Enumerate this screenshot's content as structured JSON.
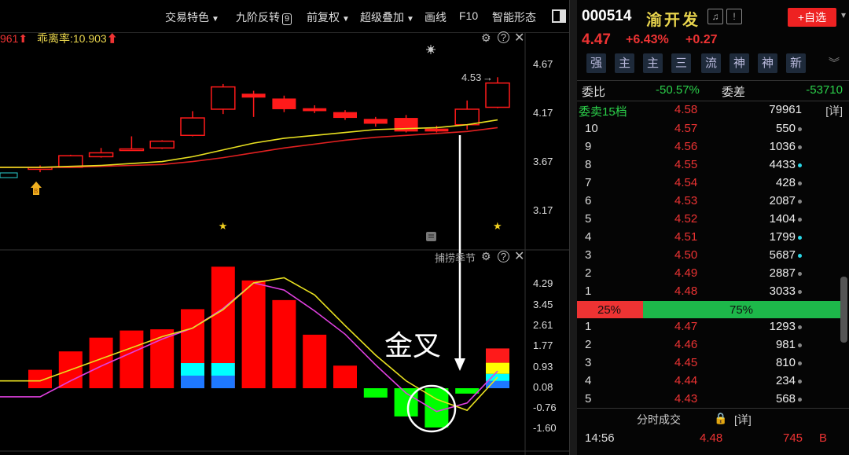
{
  "toolbar": {
    "items": [
      "交易特色",
      "九阶反转",
      "前复权",
      "超级叠加",
      "画线",
      "F10",
      "智能形态"
    ],
    "badge": "9"
  },
  "main_legend": {
    "prev_value": "961",
    "label": "乖离率:10.903"
  },
  "main_axis": [
    "4.67",
    "4.17",
    "3.67",
    "3.17"
  ],
  "price_label": "4.53",
  "sub_legend": "捕捞季节",
  "sub_axis": [
    "4.29",
    "3.45",
    "2.61",
    "1.77",
    "0.93",
    "0.08",
    "-0.76",
    "-1.60"
  ],
  "annotation": "金叉",
  "stock": {
    "code": "000514",
    "name": "渝开发",
    "price": "4.47",
    "pct": "+6.43%",
    "chg": "+0.27",
    "add_label": "+自选",
    "tags": [
      "强",
      "主",
      "主",
      "三",
      "流",
      "神",
      "神",
      "新"
    ]
  },
  "ratio": {
    "webi_label": "委比",
    "webi_value": "-50.57%",
    "wecha_label": "委差",
    "wecha_value": "-53710"
  },
  "level15": {
    "label": "委卖15档",
    "price": "4.58",
    "vol": "79961",
    "detail": "[详]"
  },
  "asks": [
    {
      "level": "10",
      "price": "4.57",
      "vol": "550",
      "dot": "gray"
    },
    {
      "level": "9",
      "price": "4.56",
      "vol": "1036",
      "dot": "gray"
    },
    {
      "level": "8",
      "price": "4.55",
      "vol": "4433",
      "dot": "cyan"
    },
    {
      "level": "7",
      "price": "4.54",
      "vol": "428",
      "dot": "gray"
    },
    {
      "level": "6",
      "price": "4.53",
      "vol": "2087",
      "dot": "gray"
    },
    {
      "level": "5",
      "price": "4.52",
      "vol": "1404",
      "dot": "gray"
    },
    {
      "level": "4",
      "price": "4.51",
      "vol": "1799",
      "dot": "cyan"
    },
    {
      "level": "3",
      "price": "4.50",
      "vol": "5687",
      "dot": "cyan"
    },
    {
      "level": "2",
      "price": "4.49",
      "vol": "2887",
      "dot": "gray"
    },
    {
      "level": "1",
      "price": "4.48",
      "vol": "3033",
      "dot": "gray"
    }
  ],
  "bar": {
    "sell_pct": "25%",
    "buy_pct": "75%",
    "sell": 0.25
  },
  "bids": [
    {
      "level": "1",
      "price": "4.47",
      "vol": "1293",
      "dot": "gray"
    },
    {
      "level": "2",
      "price": "4.46",
      "vol": "981",
      "dot": "gray"
    },
    {
      "level": "3",
      "price": "4.45",
      "vol": "810",
      "dot": "gray"
    },
    {
      "level": "4",
      "price": "4.44",
      "vol": "234",
      "dot": "gray"
    },
    {
      "level": "5",
      "price": "4.43",
      "vol": "568",
      "dot": "gray"
    }
  ],
  "trades": {
    "title": "分时成交",
    "detail": "[详]",
    "rows": [
      {
        "time": "14:56",
        "price": "4.48",
        "vol": "745",
        "side": "B"
      }
    ]
  },
  "chart_data": [
    {
      "type": "candlestick",
      "ylim": [
        2.9,
        4.9
      ],
      "ticks": [
        4.67,
        4.17,
        3.67,
        3.17
      ],
      "candles": [
        {
          "o": 3.58,
          "h": 3.62,
          "l": 3.55,
          "c": 3.6
        },
        {
          "o": 3.6,
          "h": 3.73,
          "l": 3.6,
          "c": 3.72
        },
        {
          "o": 3.71,
          "h": 3.8,
          "l": 3.7,
          "c": 3.75
        },
        {
          "o": 3.78,
          "h": 3.92,
          "l": 3.77,
          "c": 3.79
        },
        {
          "o": 3.8,
          "h": 3.88,
          "l": 3.79,
          "c": 3.87
        },
        {
          "o": 3.93,
          "h": 4.18,
          "l": 3.92,
          "c": 4.11
        },
        {
          "o": 4.2,
          "h": 4.46,
          "l": 4.15,
          "c": 4.43
        },
        {
          "o": 4.36,
          "h": 4.39,
          "l": 4.12,
          "c": 4.32
        },
        {
          "o": 4.31,
          "h": 4.34,
          "l": 4.17,
          "c": 4.2
        },
        {
          "o": 4.21,
          "h": 4.24,
          "l": 4.16,
          "c": 4.18
        },
        {
          "o": 4.17,
          "h": 4.19,
          "l": 4.09,
          "c": 4.11
        },
        {
          "o": 4.1,
          "h": 4.12,
          "l": 4.02,
          "c": 4.05
        },
        {
          "o": 4.11,
          "h": 4.14,
          "l": 3.96,
          "c": 3.97
        },
        {
          "o": 4.0,
          "h": 4.03,
          "l": 3.96,
          "c": 3.97
        },
        {
          "o": 4.04,
          "h": 4.29,
          "l": 3.99,
          "c": 4.2
        },
        {
          "o": 4.22,
          "h": 4.53,
          "l": 4.21,
          "c": 4.47
        }
      ],
      "ma1": [
        3.6,
        3.61,
        3.62,
        3.64,
        3.66,
        3.71,
        3.78,
        3.85,
        3.9,
        3.93,
        3.96,
        3.99,
        4.0,
        4.01,
        4.04,
        4.09
      ],
      "ma2": [
        3.6,
        3.6,
        3.61,
        3.62,
        3.63,
        3.66,
        3.7,
        3.75,
        3.8,
        3.84,
        3.88,
        3.91,
        3.93,
        3.95,
        3.97,
        4.01
      ],
      "stars_at": [
        6,
        15
      ]
    },
    {
      "type": "bar",
      "ylim": [
        -1.9,
        5.0
      ],
      "ticks": [
        4.29,
        3.45,
        2.61,
        1.77,
        0.93,
        0.08,
        -0.76,
        -1.6
      ],
      "values": [
        0.75,
        1.5,
        2.06,
        2.35,
        2.4,
        3.22,
        4.95,
        4.39,
        3.59,
        2.18,
        0.92,
        -0.38,
        -1.15,
        -1.6,
        -0.22,
        1.62
      ],
      "line1": [
        -0.35,
        0.3,
        0.9,
        1.45,
        2.0,
        2.45,
        3.25,
        4.29,
        4.0,
        3.15,
        2.2,
        0.95,
        -0.2,
        -0.95,
        -0.6,
        0.7
      ],
      "line2": [
        0.3,
        0.75,
        1.2,
        1.65,
        2.1,
        2.45,
        3.2,
        4.29,
        4.5,
        3.8,
        2.55,
        1.35,
        0.3,
        -0.45,
        -0.9,
        0.45
      ]
    }
  ]
}
